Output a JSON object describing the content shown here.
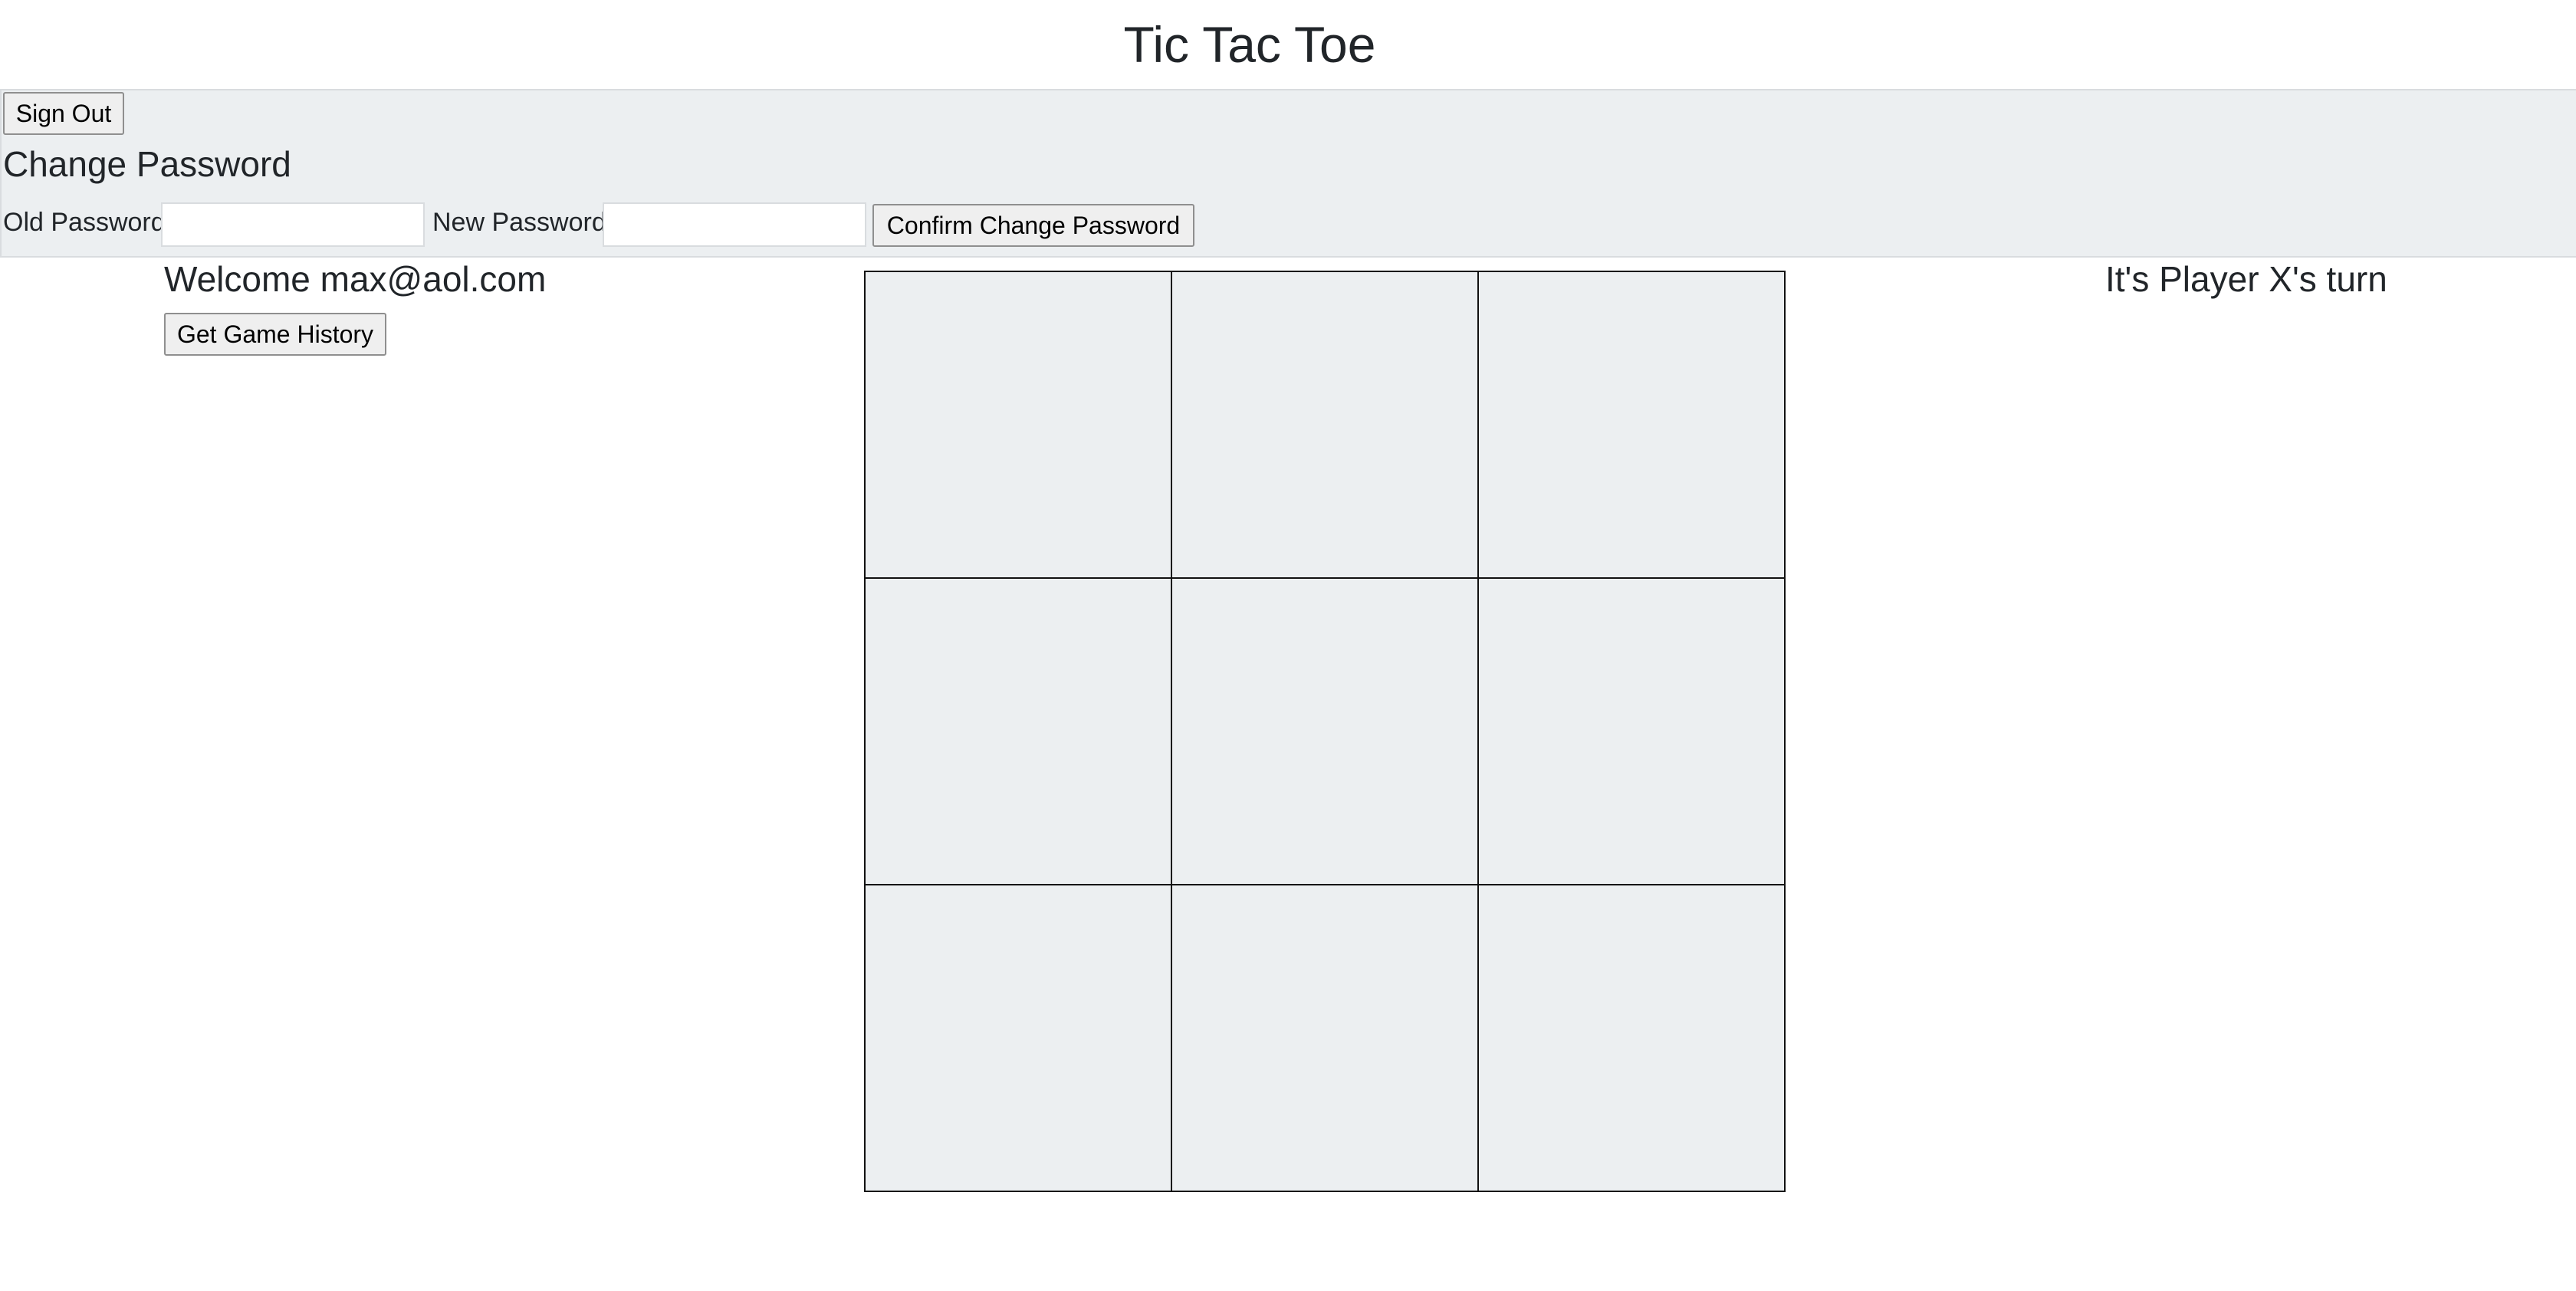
{
  "header": {
    "title": "Tic Tac Toe"
  },
  "account": {
    "sign_out_label": "Sign Out",
    "change_password_title": "Change Password",
    "old_password_label": "Old Password",
    "old_password_value": "",
    "new_password_label": "New Password",
    "new_password_value": "",
    "confirm_label": "Confirm Change Password"
  },
  "user": {
    "welcome_text": "Welcome max@aol.com",
    "history_label": "Get Game History"
  },
  "game": {
    "status_text": "It's Player X's turn",
    "cells": [
      "",
      "",
      "",
      "",
      "",
      "",
      "",
      "",
      ""
    ]
  },
  "colors": {
    "panel_background": "#eceff1",
    "cell_background": "#eceff1",
    "cell_border": "#111111",
    "text": "#212529"
  }
}
